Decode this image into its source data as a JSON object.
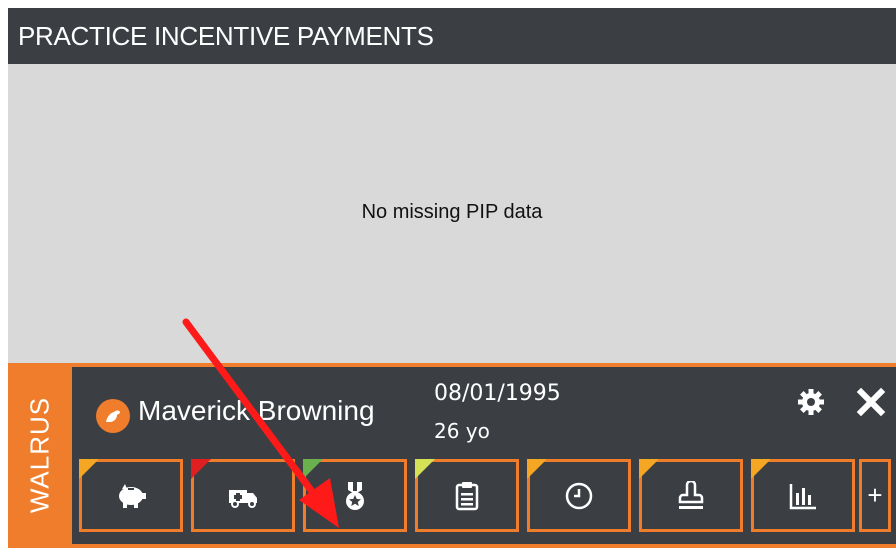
{
  "panel": {
    "title": "PRACTICE INCENTIVE PAYMENTS",
    "message": "No missing PIP data"
  },
  "widget": {
    "brand": "WALRUS",
    "patient_name": "Maverick Browning",
    "dob": "08/01/1995",
    "age": "26 yo",
    "accent_color": "#ef7d2b",
    "tiles": [
      {
        "icon": "piggy-bank-icon",
        "flag_color": "#f5a623"
      },
      {
        "icon": "ambulance-icon",
        "flag_color": "#e02020"
      },
      {
        "icon": "medal-icon",
        "flag_color": "#6ab04c"
      },
      {
        "icon": "clipboard-icon",
        "flag_color": "#d4e157"
      },
      {
        "icon": "clock-icon",
        "flag_color": "#f5a623"
      },
      {
        "icon": "stamp-icon",
        "flag_color": "#f5a623"
      },
      {
        "icon": "bar-chart-icon",
        "flag_color": "#f5a623"
      }
    ],
    "more_label": "+"
  }
}
